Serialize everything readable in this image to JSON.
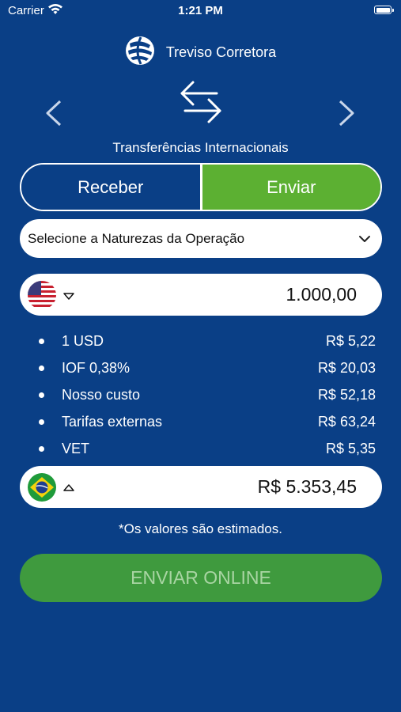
{
  "status_bar": {
    "carrier": "Carrier",
    "time": "1:21 PM"
  },
  "header": {
    "brand_name": "Treviso Corretora",
    "section_title": "Transferências Internacionais"
  },
  "segment": {
    "receive_label": "Receber",
    "send_label": "Enviar",
    "selected": "Enviar"
  },
  "operation_select": {
    "placeholder": "Selecione a Naturezas da Operação"
  },
  "source_amount": {
    "currency_flag": "us-flag-icon",
    "value": "1.000,00"
  },
  "rates": [
    {
      "label": "1 USD",
      "value": "R$ 5,22"
    },
    {
      "label": "IOF 0,38%",
      "value": "R$ 20,03"
    },
    {
      "label": "Nosso custo",
      "value": "R$ 52,18"
    },
    {
      "label": "Tarifas externas",
      "value": "R$ 63,24"
    },
    {
      "label": "VET",
      "value": "R$ 5,35"
    }
  ],
  "target_amount": {
    "currency_flag": "brazil-flag-icon",
    "value": "R$ 5.353,45"
  },
  "note": "*Os valores são estimados.",
  "cta_label": "ENVIAR ONLINE",
  "colors": {
    "background": "#0a3f86",
    "accent_green": "#5cb032",
    "cta_green": "#3f9a3e",
    "cta_text": "#a9d5a3"
  }
}
